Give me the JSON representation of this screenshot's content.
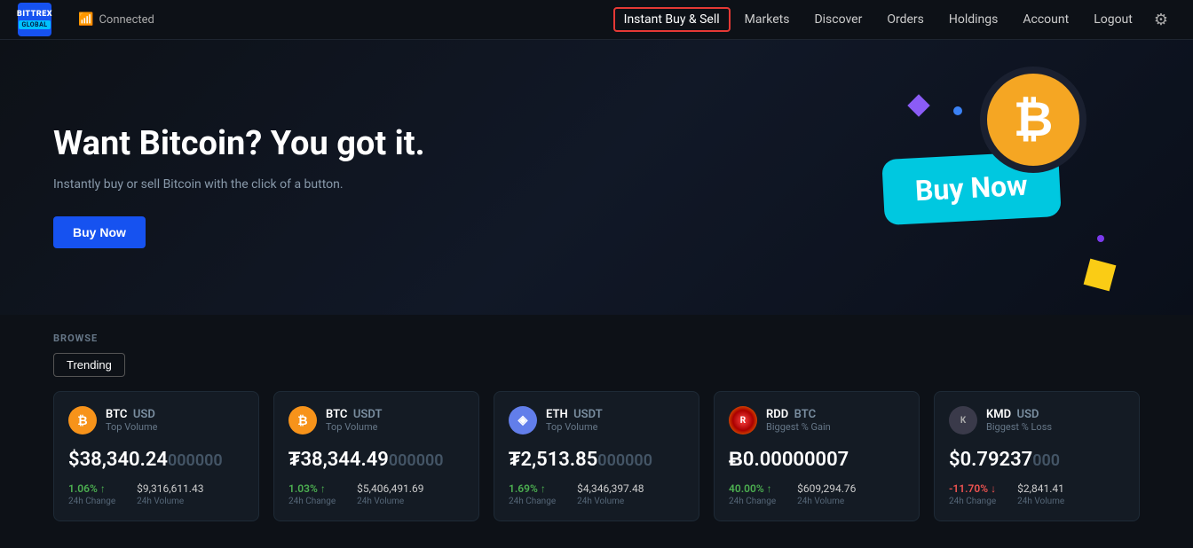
{
  "header": {
    "logo_top": "BITTREX",
    "logo_bottom": "GLOBAL",
    "connection_label": "Connected",
    "nav": {
      "instant_buy_sell": "Instant Buy & Sell",
      "markets": "Markets",
      "discover": "Discover",
      "orders": "Orders",
      "holdings": "Holdings",
      "account": "Account",
      "logout": "Logout"
    }
  },
  "hero": {
    "title": "Want Bitcoin? You got it.",
    "subtitle": "Instantly buy or sell Bitcoin with the click of a button.",
    "buy_button": "Buy Now",
    "bubble_text": "Buy Now"
  },
  "browse": {
    "label": "BROWSE",
    "tabs": [
      {
        "id": "trending",
        "label": "Trending",
        "active": true
      }
    ]
  },
  "cards": [
    {
      "id": "btc-usd",
      "coin": "BTC",
      "quote": "USD",
      "icon_type": "btc",
      "volume_label": "Top Volume",
      "price_significant": "$38,340.24",
      "price_trailing": "000000",
      "change_value": "1.06%",
      "change_dir": "up",
      "change_label": "24h Change",
      "volume_value": "$9,316,611.43",
      "volume_stat_label": "24h Volume"
    },
    {
      "id": "btc-usdt",
      "coin": "BTC",
      "quote": "USDT",
      "icon_type": "btc",
      "volume_label": "Top Volume",
      "price_significant": "₮38,344.49",
      "price_trailing": "000000",
      "change_value": "1.03%",
      "change_dir": "up",
      "change_label": "24h Change",
      "volume_value": "$5,406,491.69",
      "volume_stat_label": "24h Volume"
    },
    {
      "id": "eth-usdt",
      "coin": "ETH",
      "quote": "USDT",
      "icon_type": "eth",
      "volume_label": "Top Volume",
      "price_significant": "₮2,513.85",
      "price_trailing": "000000",
      "change_value": "1.69%",
      "change_dir": "up",
      "change_label": "24h Change",
      "volume_value": "$4,346,397.48",
      "volume_stat_label": "24h Volume"
    },
    {
      "id": "rdd-btc",
      "coin": "RDD",
      "quote": "BTC",
      "icon_type": "rdd",
      "volume_label": "Biggest % Gain",
      "price_significant": "Ƀ0.00000007",
      "price_trailing": "",
      "change_value": "40.00%",
      "change_dir": "up",
      "change_label": "24h Change",
      "volume_value": "$609,294.76",
      "volume_stat_label": "24h Volume"
    },
    {
      "id": "kmd-usd",
      "coin": "KMD",
      "quote": "USD",
      "icon_type": "kmd",
      "volume_label": "Biggest % Loss",
      "price_significant": "$0.79237",
      "price_trailing": "000",
      "change_value": "-11.70%",
      "change_dir": "down",
      "change_label": "24h Change",
      "volume_value": "$2,841.41",
      "volume_stat_label": "24h Volume"
    }
  ]
}
